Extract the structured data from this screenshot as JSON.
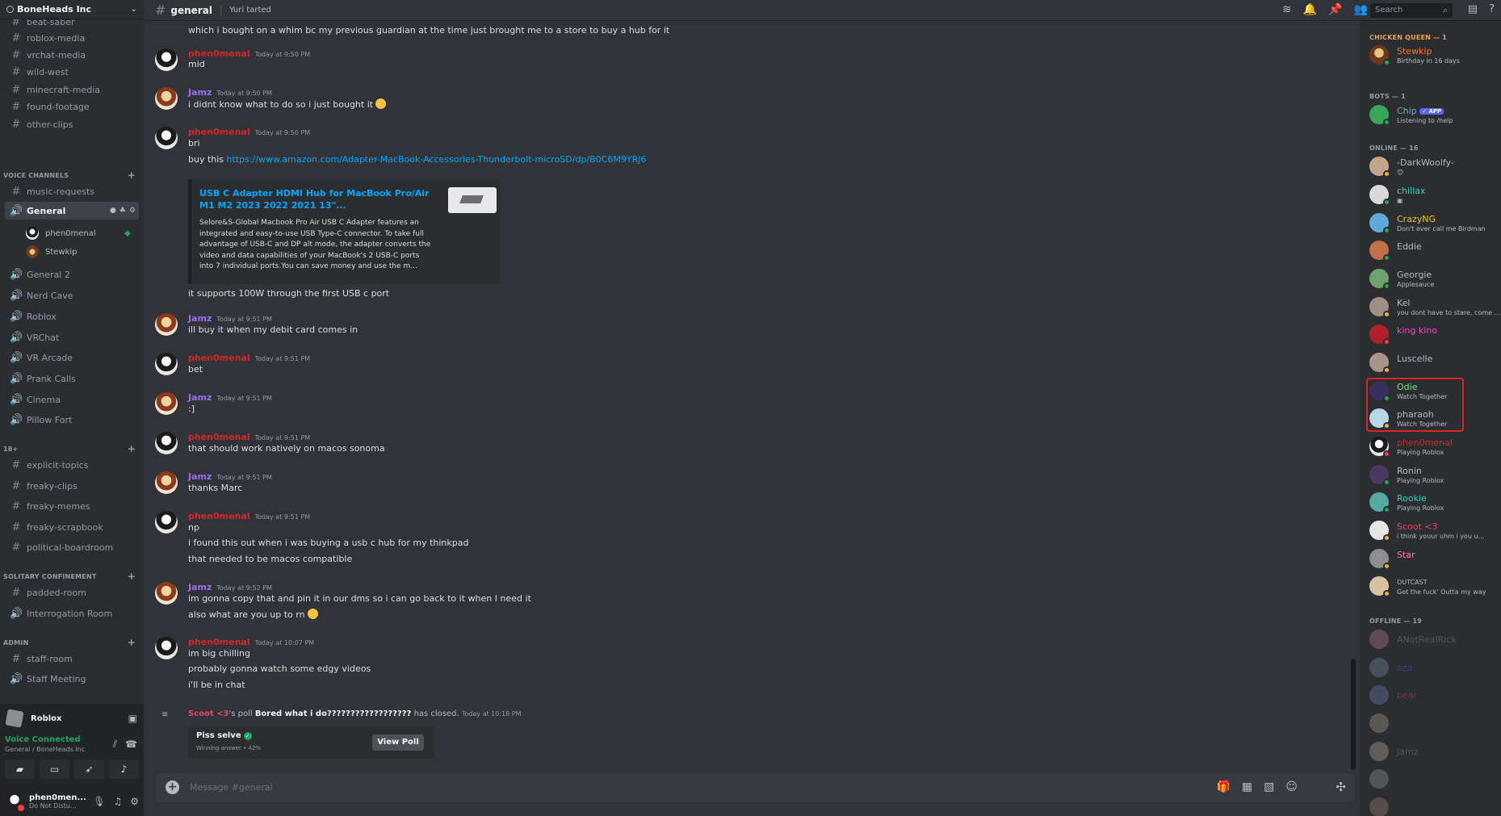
{
  "server": {
    "name": "BoneHeads Inc"
  },
  "sidebar": {
    "text_channels_top": [
      {
        "label": "beat-saber"
      },
      {
        "label": "roblox-media"
      },
      {
        "label": "vrchat-media"
      },
      {
        "label": "wild-west"
      },
      {
        "label": "minecraft-media"
      },
      {
        "label": "found-footage"
      },
      {
        "label": "other-clips"
      }
    ],
    "voice_category": "VOICE CHANNELS",
    "voice_channels": [
      {
        "label": "music-requests",
        "kind": "text"
      },
      {
        "label": "General",
        "kind": "voice",
        "active": true
      },
      {
        "label": "General 2",
        "kind": "voice"
      },
      {
        "label": "Nerd Cave",
        "kind": "voice"
      },
      {
        "label": "Roblox",
        "kind": "voice"
      },
      {
        "label": "VRChat",
        "kind": "voice"
      },
      {
        "label": "VR Arcade",
        "kind": "voice"
      },
      {
        "label": "Prank Calls",
        "kind": "voice"
      },
      {
        "label": "Cinema",
        "kind": "voice"
      },
      {
        "label": "Pillow Fort",
        "kind": "voice"
      }
    ],
    "voice_users": [
      {
        "label": "phen0menal"
      },
      {
        "label": "Stewkip"
      }
    ],
    "cat_18": "18+",
    "channels_18": [
      {
        "label": "explicit-topics"
      },
      {
        "label": "freaky-clips"
      },
      {
        "label": "freaky-memes"
      },
      {
        "label": "freaky-scrapbook"
      },
      {
        "label": "political-boardroom"
      }
    ],
    "cat_solitary": "SOLITARY CONFINEMENT",
    "channels_solitary": [
      {
        "label": "padded-room",
        "kind": "text"
      },
      {
        "label": "Interrogation Room",
        "kind": "voice"
      }
    ],
    "cat_admin": "ADMIN",
    "channels_admin": [
      {
        "label": "staff-room",
        "kind": "text"
      },
      {
        "label": "Staff Meeting",
        "kind": "voice"
      }
    ],
    "activity": "Roblox",
    "voice_status": "Voice Connected",
    "voice_location": "General / BoneHeads Inc",
    "user": {
      "name": "phen0men...",
      "status": "Do Not Distu..."
    }
  },
  "topbar": {
    "channel": "general",
    "topic": "Yuri tarted",
    "search_placeholder": "Search"
  },
  "messages": [
    {
      "author": "",
      "ts": "",
      "lines": [
        "which i bought on a whim bc my previous guardian at the time just brought me to a store to buy a hub for it"
      ]
    },
    {
      "author": "phen0menal",
      "ts": "Today at 9:50 PM",
      "lines": [
        "mid"
      ]
    },
    {
      "author": "Jamz",
      "ts": "Today at 9:50 PM",
      "lines": [
        "i didnt know what to do so i just bought it"
      ]
    },
    {
      "author": "phen0menal",
      "ts": "Today at 9:50 PM",
      "lines": [
        "bri",
        "buy this "
      ],
      "link": "https://www.amazon.com/Adapter-MacBook-Accessories-Thunderbolt-microSD/dp/B0C6M9YRJ6",
      "after_embed": "it supports 100W through the first USB c port"
    },
    {
      "author": "Jamz",
      "ts": "Today at 9:51 PM",
      "lines": [
        "ill buy it when my debit card comes in"
      ]
    },
    {
      "author": "phen0menal",
      "ts": "Today at 9:51 PM",
      "lines": [
        "bet"
      ]
    },
    {
      "author": "Jamz",
      "ts": "Today at 9:51 PM",
      "lines": [
        ":]"
      ]
    },
    {
      "author": "phen0menal",
      "ts": "Today at 9:51 PM",
      "lines": [
        "that should work natively on macos sonoma"
      ]
    },
    {
      "author": "Jamz",
      "ts": "Today at 9:51 PM",
      "lines": [
        "thanks Marc"
      ]
    },
    {
      "author": "phen0menal",
      "ts": "Today at 9:51 PM",
      "lines": [
        "np",
        "i found this out when i was buying a usb c hub for my thinkpad",
        "that needed to be macos compatible"
      ]
    },
    {
      "author": "Jamz",
      "ts": "Today at 9:52 PM",
      "lines": [
        "im gonna copy that and pin it in our dms so i can go back to it when I need it",
        "also what are you up to rn"
      ]
    },
    {
      "author": "phen0menal",
      "ts": "Today at 10:07 PM",
      "lines": [
        "im big chilling",
        "probably gonna watch some edgy videos",
        "i'll be in chat"
      ]
    }
  ],
  "embed": {
    "title": "USB C Adapter HDMI Hub for MacBook Pro/Air M1 M2 2023 2022 2021 13\"...",
    "desc": "Selore&S-Global Macbook Pro Air USB C Adapter features an integrated and easy-to-use USB Type-C connector. To take full advantage of USB-C and DP alt mode, the adapter converts the video and data capabilities of your MacBook's 2 USB-C ports into 7 individual ports.You can save money and use the m..."
  },
  "poll": {
    "author": "Scoot <3",
    "poss": "'s poll ",
    "question": "Bored what i do??????????????????",
    "closed": " has closed.",
    "ts": "Today at 10:18 PM",
    "winner": "Piss selve",
    "winning_note": "Winning answer • 42%",
    "button": "View Poll"
  },
  "composer": {
    "placeholder": "Message #general"
  },
  "members": {
    "cat_chicken": "CHICKEN QUEEN — 1",
    "cat_bots": "BOTS — 1",
    "cat_online": "ONLINE — 16",
    "cat_offline": "OFFLINE — 19",
    "chicken": [
      {
        "name": "Stewkip",
        "sub": "Birthday in 16 days",
        "color": "#f47b2a"
      }
    ],
    "bots": [
      {
        "name": "Chip",
        "badge": "✓ APP",
        "sub": "Listening to /help",
        "color": "#5fb0c9"
      }
    ],
    "online": [
      {
        "name": "-DarkWoolfy-",
        "sub": "",
        "color": "#b5bac1"
      },
      {
        "name": "chillax",
        "sub": "",
        "color": "#2dd4bf"
      },
      {
        "name": "CrazyNG",
        "sub": "Don't ever call me Birdman",
        "color": "#f0c419"
      },
      {
        "name": "Eddie",
        "sub": "",
        "color": "#b5bac1"
      },
      {
        "name": "Georgie",
        "sub": "Applesauce",
        "color": "#b5bac1"
      },
      {
        "name": "Kel",
        "sub": "you dont have to stare, come ...",
        "color": "#b5bac1"
      },
      {
        "name": "king kino",
        "sub": "",
        "color": "#f047c7"
      },
      {
        "name": "Luscelle",
        "sub": "",
        "color": "#b5bac1"
      },
      {
        "name": "Odie",
        "sub": "Watch Together",
        "color": "#57f287"
      },
      {
        "name": "pharaoh",
        "sub": "Watch Together",
        "color": "#b5bac1"
      },
      {
        "name": "phen0menal",
        "sub": "Playing Roblox",
        "color": "#d2292b"
      },
      {
        "name": "Ronin",
        "sub": "Playing Roblox",
        "color": "#b5bac1"
      },
      {
        "name": "Rookie",
        "sub": "Playing Roblox",
        "color": "#2dd4bf"
      },
      {
        "name": "Scoot <3",
        "sub": "i think youur uhm i you u...",
        "color": "#e64a63"
      },
      {
        "name": "Star",
        "sub": "",
        "color": "#ff7bb0"
      },
      {
        "name": "OUTCAST",
        "sub": "Get the fuck' Outta my way",
        "color": "#b5bac1"
      }
    ],
    "offline": [
      {
        "name": "ANotRealRick",
        "color": "#949ba4"
      },
      {
        "name": "aza",
        "color": "#5865f2"
      },
      {
        "name": "bear",
        "color": "#e64a63"
      },
      {
        "name": "",
        "color": "#949ba4"
      },
      {
        "name": "Jamz",
        "color": "#949ba4"
      },
      {
        "name": "",
        "color": "#949ba4"
      },
      {
        "name": "",
        "color": "#e64a63"
      }
    ]
  }
}
